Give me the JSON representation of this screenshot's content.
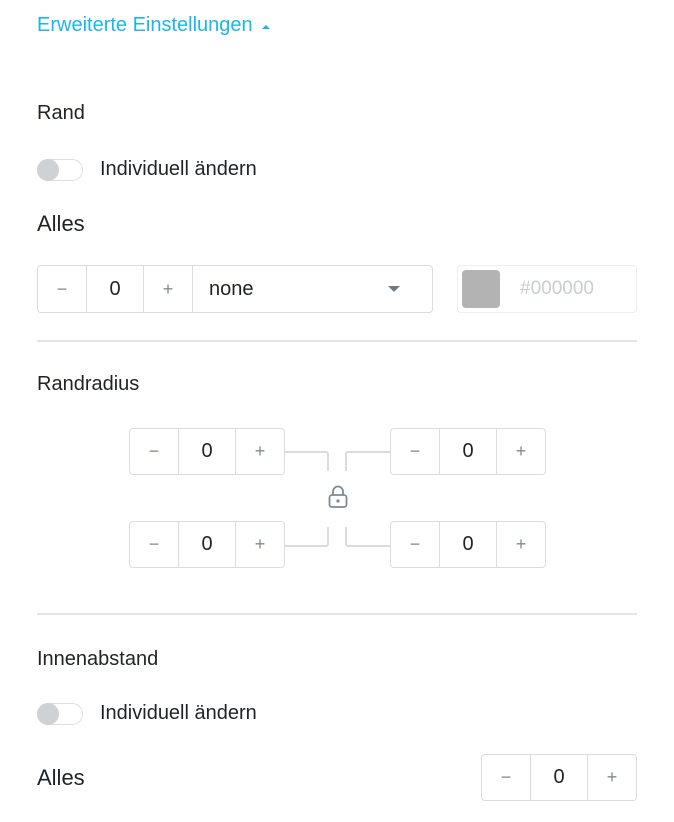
{
  "header": {
    "advanced_settings_label": "Erweiterte Einstellungen"
  },
  "border": {
    "title": "Rand",
    "toggle_label": "Individuell ändern",
    "toggle_on": false,
    "all_label": "Alles",
    "width_value": "0",
    "minus_label": "−",
    "plus_label": "+",
    "style_selected": "none",
    "color_swatch": "#b3b3b3",
    "color_placeholder": "#000000"
  },
  "radius": {
    "title": "Randradius",
    "lock_icon": "lock-icon",
    "top_left": "0",
    "top_right": "0",
    "bottom_left": "0",
    "bottom_right": "0",
    "minus_label": "−",
    "plus_label": "+"
  },
  "padding": {
    "title": "Innenabstand",
    "toggle_label": "Individuell ändern",
    "toggle_on": false,
    "all_label": "Alles",
    "value": "0",
    "minus_label": "−",
    "plus_label": "+"
  },
  "colors": {
    "accent": "#1ab7ea",
    "border": "#d9dde2",
    "text": "#1f2328",
    "icon": "#7f8a96"
  }
}
